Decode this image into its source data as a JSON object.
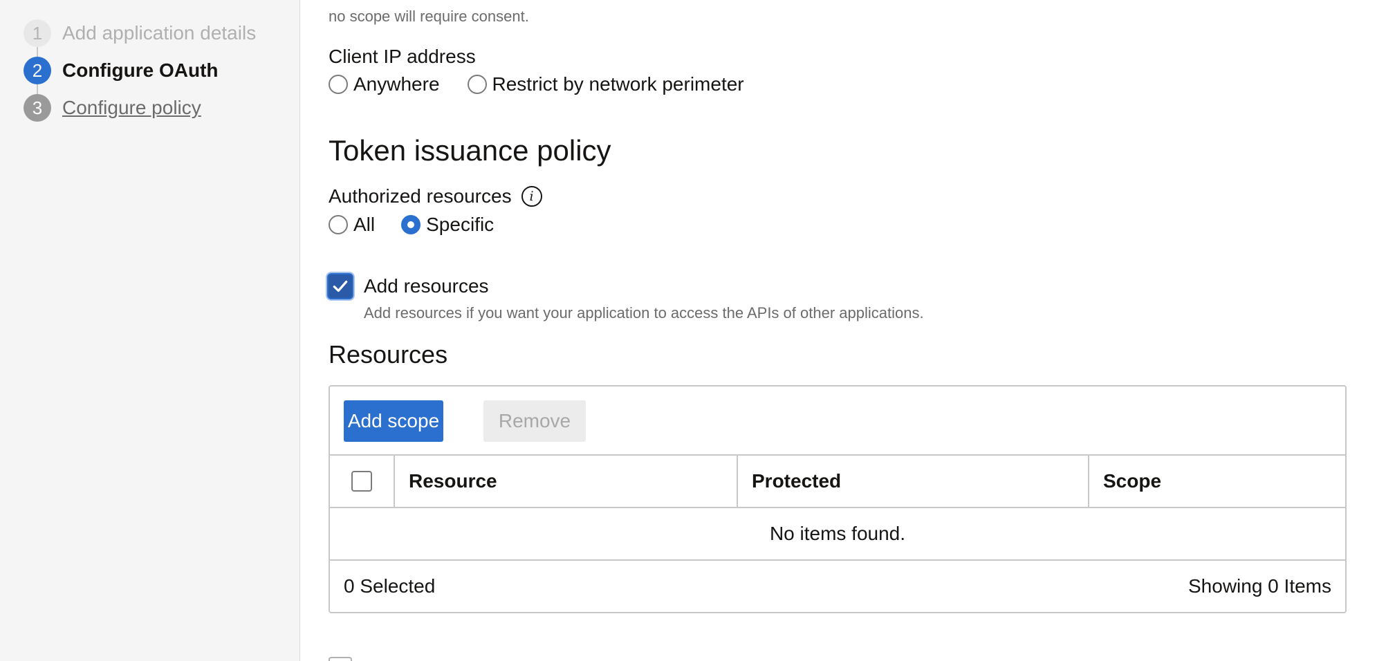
{
  "steps": [
    {
      "number": "1",
      "label": "Add application details"
    },
    {
      "number": "2",
      "label": "Configure OAuth"
    },
    {
      "number": "3",
      "label": "Configure policy"
    }
  ],
  "top_partial_text": "no scope will require consent.",
  "client_ip": {
    "label": "Client IP address",
    "options": [
      "Anywhere",
      "Restrict by network perimeter"
    ]
  },
  "token_policy": {
    "heading": "Token issuance policy",
    "authorized_resources_label": "Authorized resources",
    "options": [
      "All",
      "Specific"
    ],
    "selected": "Specific"
  },
  "add_resources": {
    "label": "Add resources",
    "checked": true,
    "help": "Add resources if you want your application to access the APIs of other applications."
  },
  "resources": {
    "heading": "Resources",
    "add_scope_label": "Add scope",
    "remove_label": "Remove",
    "columns": [
      "Resource",
      "Protected",
      "Scope"
    ],
    "empty_text": "No items found.",
    "selected_text": "0 Selected",
    "showing_text": "Showing 0 Items"
  },
  "colors": {
    "accent": "#2b6fcf",
    "text": "#161513",
    "muted": "#6b6b6b"
  }
}
